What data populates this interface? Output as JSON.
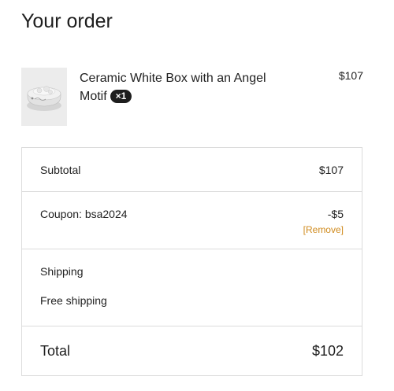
{
  "page": {
    "title": "Your order"
  },
  "item": {
    "name": "Ceramic White Box with an Angel Motif",
    "quantity": "×1",
    "price": "$107",
    "image_icon": "ceramic-box-image"
  },
  "totals": {
    "subtotal_label": "Subtotal",
    "subtotal_value": "$107",
    "coupon_label": "Coupon: bsa2024",
    "coupon_value": "-$5",
    "coupon_remove": "[Remove]",
    "shipping_label": "Shipping",
    "shipping_value": "Free shipping",
    "total_label": "Total",
    "total_value": "$102"
  },
  "colors": {
    "remove_link": "#d08b1e",
    "border": "#dcdcdc",
    "badge": "#1e1e1e"
  }
}
